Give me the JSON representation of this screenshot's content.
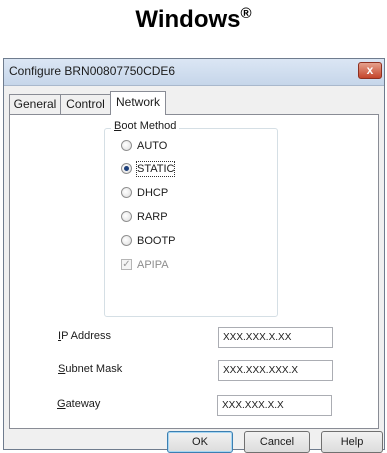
{
  "page_heading": {
    "text": "Windows",
    "superscript": "®"
  },
  "dialog": {
    "title": "Configure BRN00807750CDE6",
    "close_glyph": "x",
    "tabs": [
      {
        "label": "General",
        "active": false
      },
      {
        "label": "Control",
        "active": false
      },
      {
        "label": "Network",
        "active": true
      }
    ],
    "boot_method": {
      "group_label_underlined": "B",
      "group_label_rest": "oot Method",
      "options": [
        {
          "label": "AUTO",
          "checked": false
        },
        {
          "label": "STATIC",
          "checked": true
        },
        {
          "label": "DHCP",
          "checked": false
        },
        {
          "label": "RARP",
          "checked": false
        },
        {
          "label": "BOOTP",
          "checked": false
        }
      ],
      "apipa": {
        "label": "APIPA",
        "checked": true,
        "disabled": true
      }
    },
    "fields": [
      {
        "label_underlined": "I",
        "label_rest": "P Address",
        "value": "XXX.XXX.X.XX"
      },
      {
        "label_underlined": "S",
        "label_rest": "ubnet Mask",
        "value": "XXX.XXX.XXX.X"
      },
      {
        "label_underlined": "G",
        "label_rest": "ateway",
        "value": "XXX.XXX.X.X"
      }
    ],
    "buttons": {
      "ok": "OK",
      "cancel": "Cancel",
      "help": "Help"
    }
  }
}
